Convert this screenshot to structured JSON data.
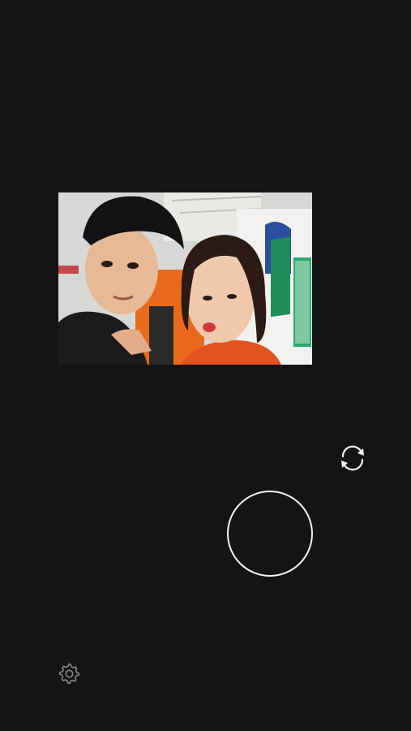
{
  "app": {
    "screen": "camera"
  },
  "preview": {
    "description_icon": "photo-preview"
  },
  "controls": {
    "flip_camera": {
      "icon": "flip-camera-icon"
    },
    "shutter": {
      "icon": "shutter-button"
    },
    "settings": {
      "icon": "gear-icon"
    }
  },
  "colors": {
    "background": "#141414",
    "controls": "#f2f2f2",
    "settings_icon": "#8a8a8a"
  }
}
